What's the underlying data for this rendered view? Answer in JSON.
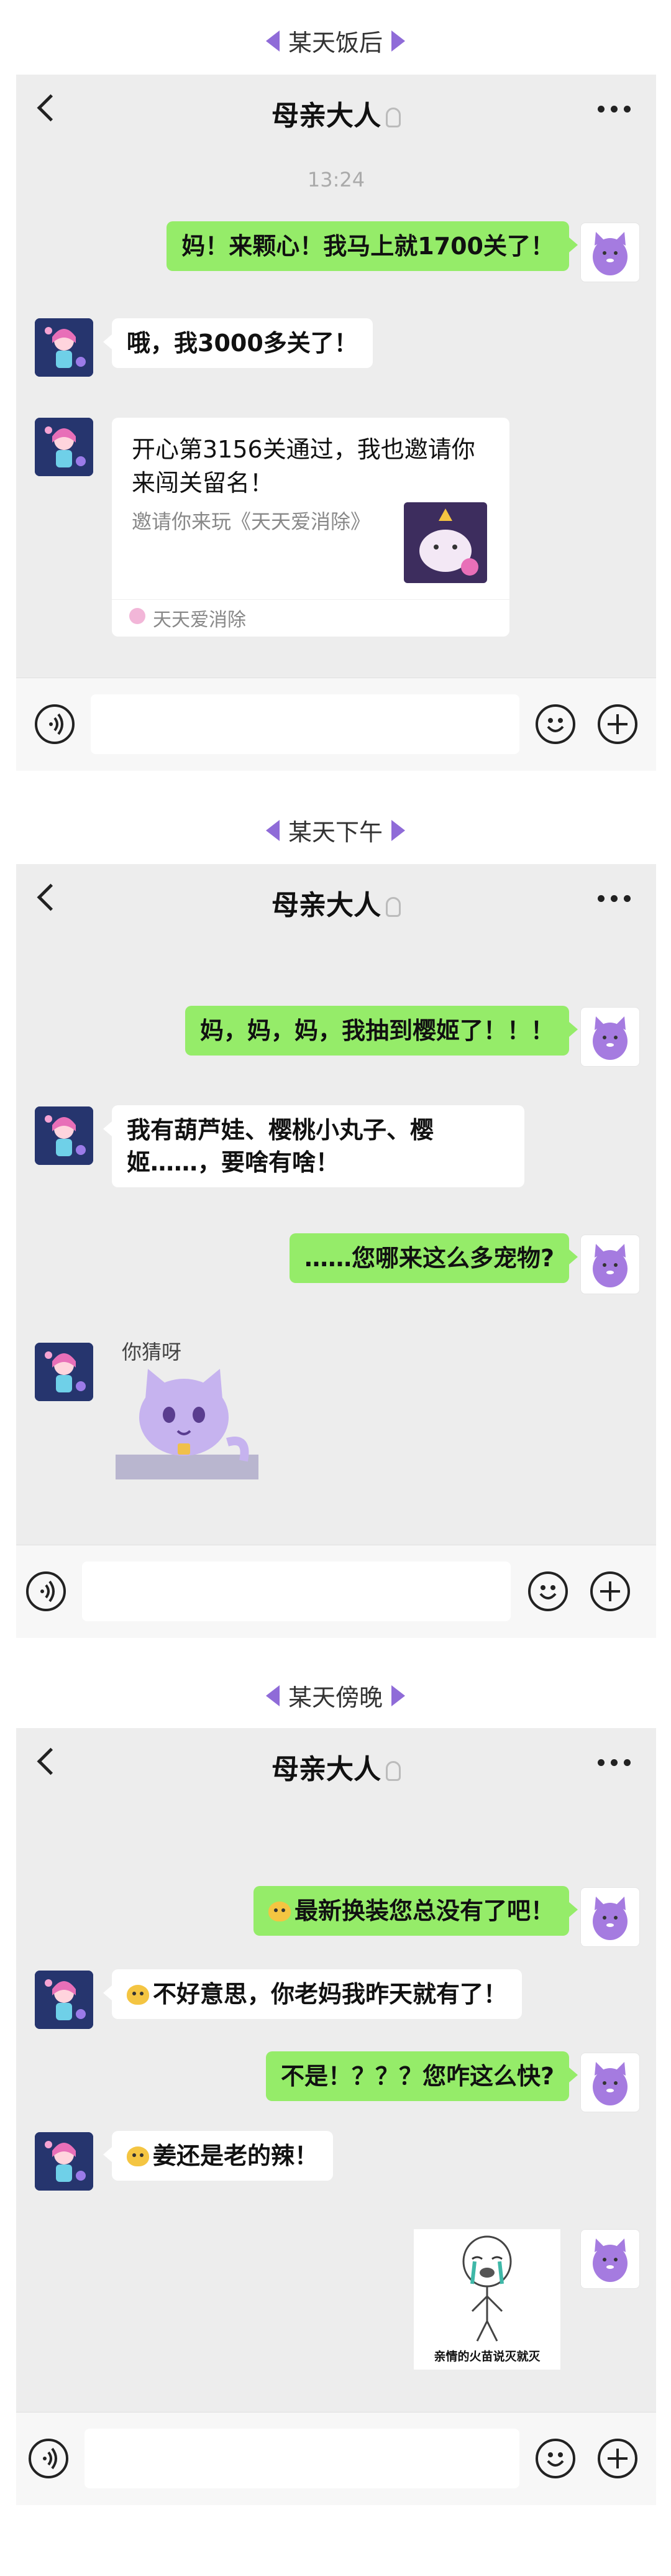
{
  "chat": {
    "title": "母亲大人",
    "more_label": "···"
  },
  "scene1": {
    "caption": "某天饭后",
    "time": "13:24",
    "msg1": "妈！来颗心！我马上就1700关了！",
    "msg2": "哦，我3000多关了！",
    "card_title": "开心第3156关通过，我也邀请你来闯关留名！",
    "card_desc": "邀请你来玩《天天爱消除》",
    "card_app": "天天爱消除"
  },
  "scene2": {
    "caption": "某天下午",
    "msg1": "妈，妈，妈，我抽到樱姬了！！！",
    "msg2": "我有葫芦娃、樱桃小丸子、樱姬……，要啥有啥！",
    "msg3": "……您哪来这么多宠物?",
    "sticker_text": "你猜呀"
  },
  "scene3": {
    "caption": "某天傍晚",
    "msg1": "最新换装您总没有了吧！",
    "msg2": "不好意思，你老妈我昨天就有了！",
    "msg3": "不是！？？？您咋这么快?",
    "msg4": "姜还是老的辣！",
    "sticker_text": "亲情的火苗说灭就灭"
  },
  "colors": {
    "sent_bubble": "#95ec69",
    "received_bubble": "#ffffff",
    "chat_background": "#ededed",
    "caption_triangle": "#8f6bd8"
  },
  "icons": [
    "back-arrow-icon",
    "earpiece-icon",
    "more-icon",
    "voice-icon",
    "emoji-icon",
    "plus-icon",
    "cat-avatar-icon",
    "girl-avatar-icon"
  ]
}
